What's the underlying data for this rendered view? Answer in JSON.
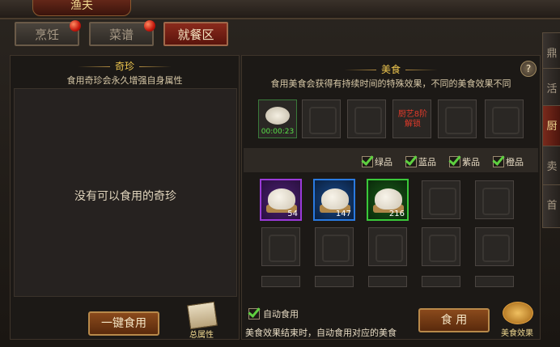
{
  "window": {
    "title": "渔夫"
  },
  "tabs": [
    {
      "label": "烹饪",
      "badge": true
    },
    {
      "label": "菜谱",
      "badge": true
    },
    {
      "label": "就餐区",
      "active": true
    }
  ],
  "left_panel": {
    "title": "奇珍",
    "subtitle": "食用奇珍会永久增强自身属性",
    "empty_text": "没有可以食用的奇珍",
    "eat_all_button": "一键食用",
    "attr_book_label": "总属性"
  },
  "right_panel": {
    "title": "美食",
    "subtitle": "食用美食会获得有持续时间的特殊效果，不同的美食效果不同",
    "help_label": "?",
    "active_slot_timer": "00:00:23",
    "locked_slot_text": "厨艺8阶解锁",
    "filters": [
      {
        "label": "绿品",
        "checked": true
      },
      {
        "label": "蓝品",
        "checked": true
      },
      {
        "label": "紫品",
        "checked": true
      },
      {
        "label": "橙品",
        "checked": true
      }
    ],
    "foods": [
      {
        "quality": "purple",
        "count": "54"
      },
      {
        "quality": "blue",
        "count": "147"
      },
      {
        "quality": "green",
        "count": "216"
      }
    ],
    "auto_eat_label": "自动食用",
    "auto_eat_checked": true,
    "auto_eat_hint": "美食效果结束时，自动食用对应的美食",
    "eat_button": "食 用",
    "effect_label": "美食效果"
  },
  "side_tabs": [
    "鼎",
    "活",
    "厨",
    "卖",
    "首"
  ],
  "colors": {
    "purple": "#9a3ad8",
    "blue": "#2a7ae0",
    "green": "#3ac83a",
    "accent": "#f0c850"
  }
}
